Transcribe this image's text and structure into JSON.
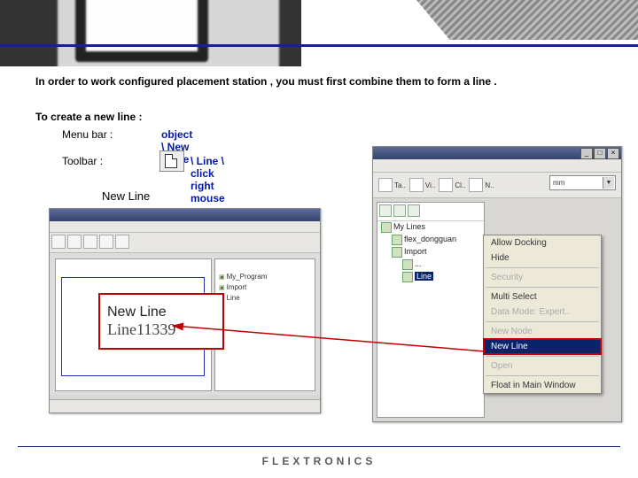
{
  "text": {
    "intro": "In order to work configured placement station , you must first  combine them to form a line .",
    "subhead": "To create a new line :",
    "menubar_label": "Menu bar :",
    "menubar_value": "object \\ New \\ Line",
    "toolbar_label": "Toolbar  :",
    "toolbar_value": "\\   Line \\ click right mouse",
    "newline_label": "New Line"
  },
  "callout": {
    "title": "New Line",
    "value": "Line11339"
  },
  "left_tree": [
    "My_Program",
    "Import",
    "Line"
  ],
  "right_toolbar": [
    "Ta..",
    "Vi..",
    "Cl..",
    "N.."
  ],
  "right_dropdown": "mm",
  "right_tree": [
    "My Lines",
    "flex_dongguan",
    "Import",
    "...",
    "Line"
  ],
  "ctxmenu": [
    "Allow Docking",
    "Hide",
    "Security",
    "Multi Select",
    "Data Mode: Expert..",
    "New Node",
    "New Line",
    "Open",
    "Float in Main Window"
  ],
  "footer": {
    "logo": "FLEXTRONICS"
  }
}
